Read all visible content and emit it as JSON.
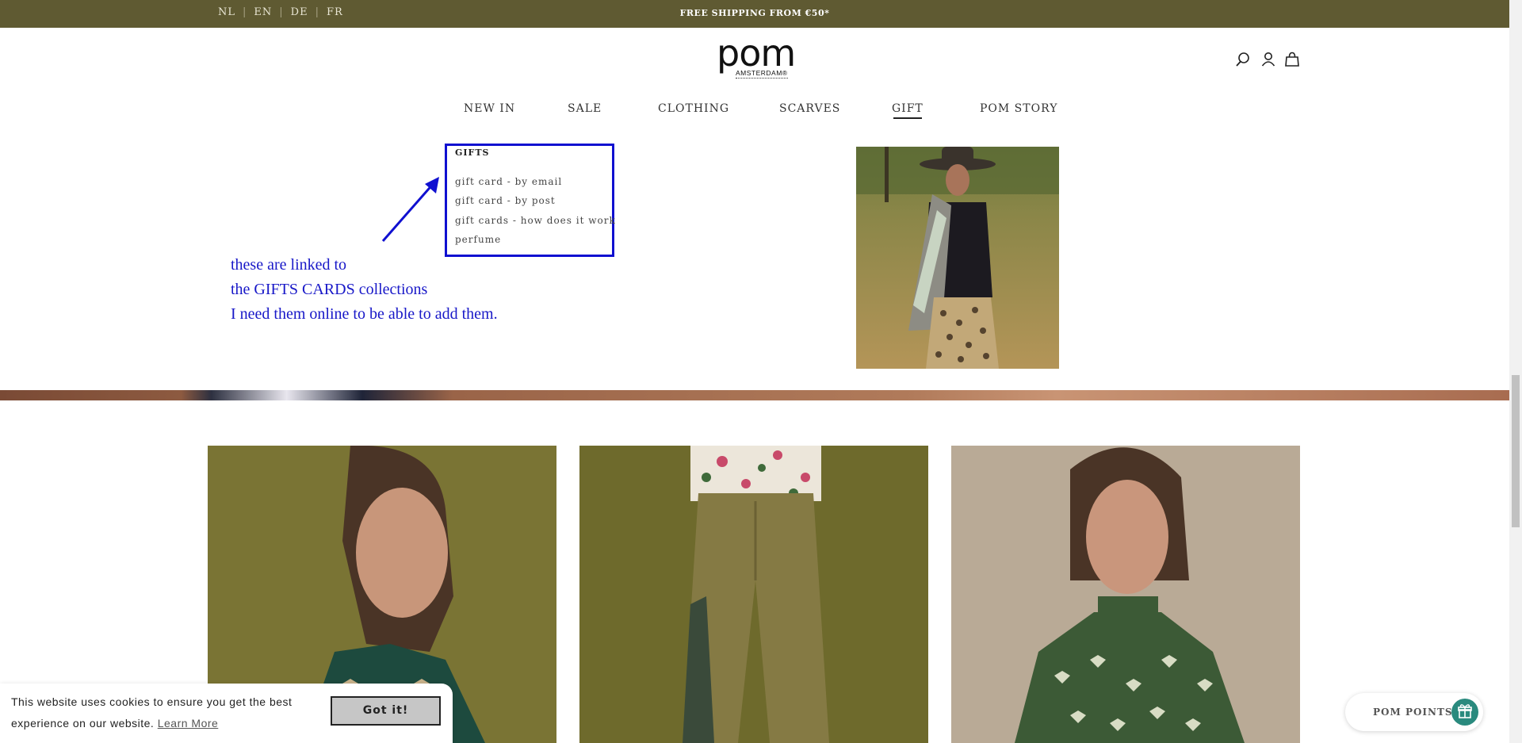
{
  "topbar": {
    "languages": [
      "NL",
      "EN",
      "DE",
      "FR"
    ],
    "shipping": "FREE SHIPPING FROM €50*"
  },
  "logo": {
    "word": "pom",
    "sub": "AMSTERDAM®"
  },
  "header_icons": [
    "search-icon",
    "account-icon",
    "bag-icon"
  ],
  "nav": {
    "items": [
      "NEW IN",
      "SALE",
      "CLOTHING",
      "SCARVES",
      "GIFT",
      "POM STORY"
    ],
    "active": "GIFT"
  },
  "gifts_menu": {
    "title": "GIFTS",
    "links": [
      "gift card - by email",
      "gift card - by post",
      "gift cards - how does it work",
      "perfume"
    ]
  },
  "annotation": {
    "lines": [
      "these are linked to",
      "the GIFTS CARDS collections",
      "I need them online to be able to add them."
    ]
  },
  "cookie": {
    "text": "This website uses cookies to ensure you get the best experience on our website.",
    "learn_more": "Learn More",
    "button": "Got it!"
  },
  "pom_points": {
    "label": "POM POINTS"
  },
  "colors": {
    "topbar": "#5f5a32",
    "annotation": "#1010d0",
    "pom_points_accent": "#2a8a7e",
    "olive_bg": "#7a7434"
  }
}
